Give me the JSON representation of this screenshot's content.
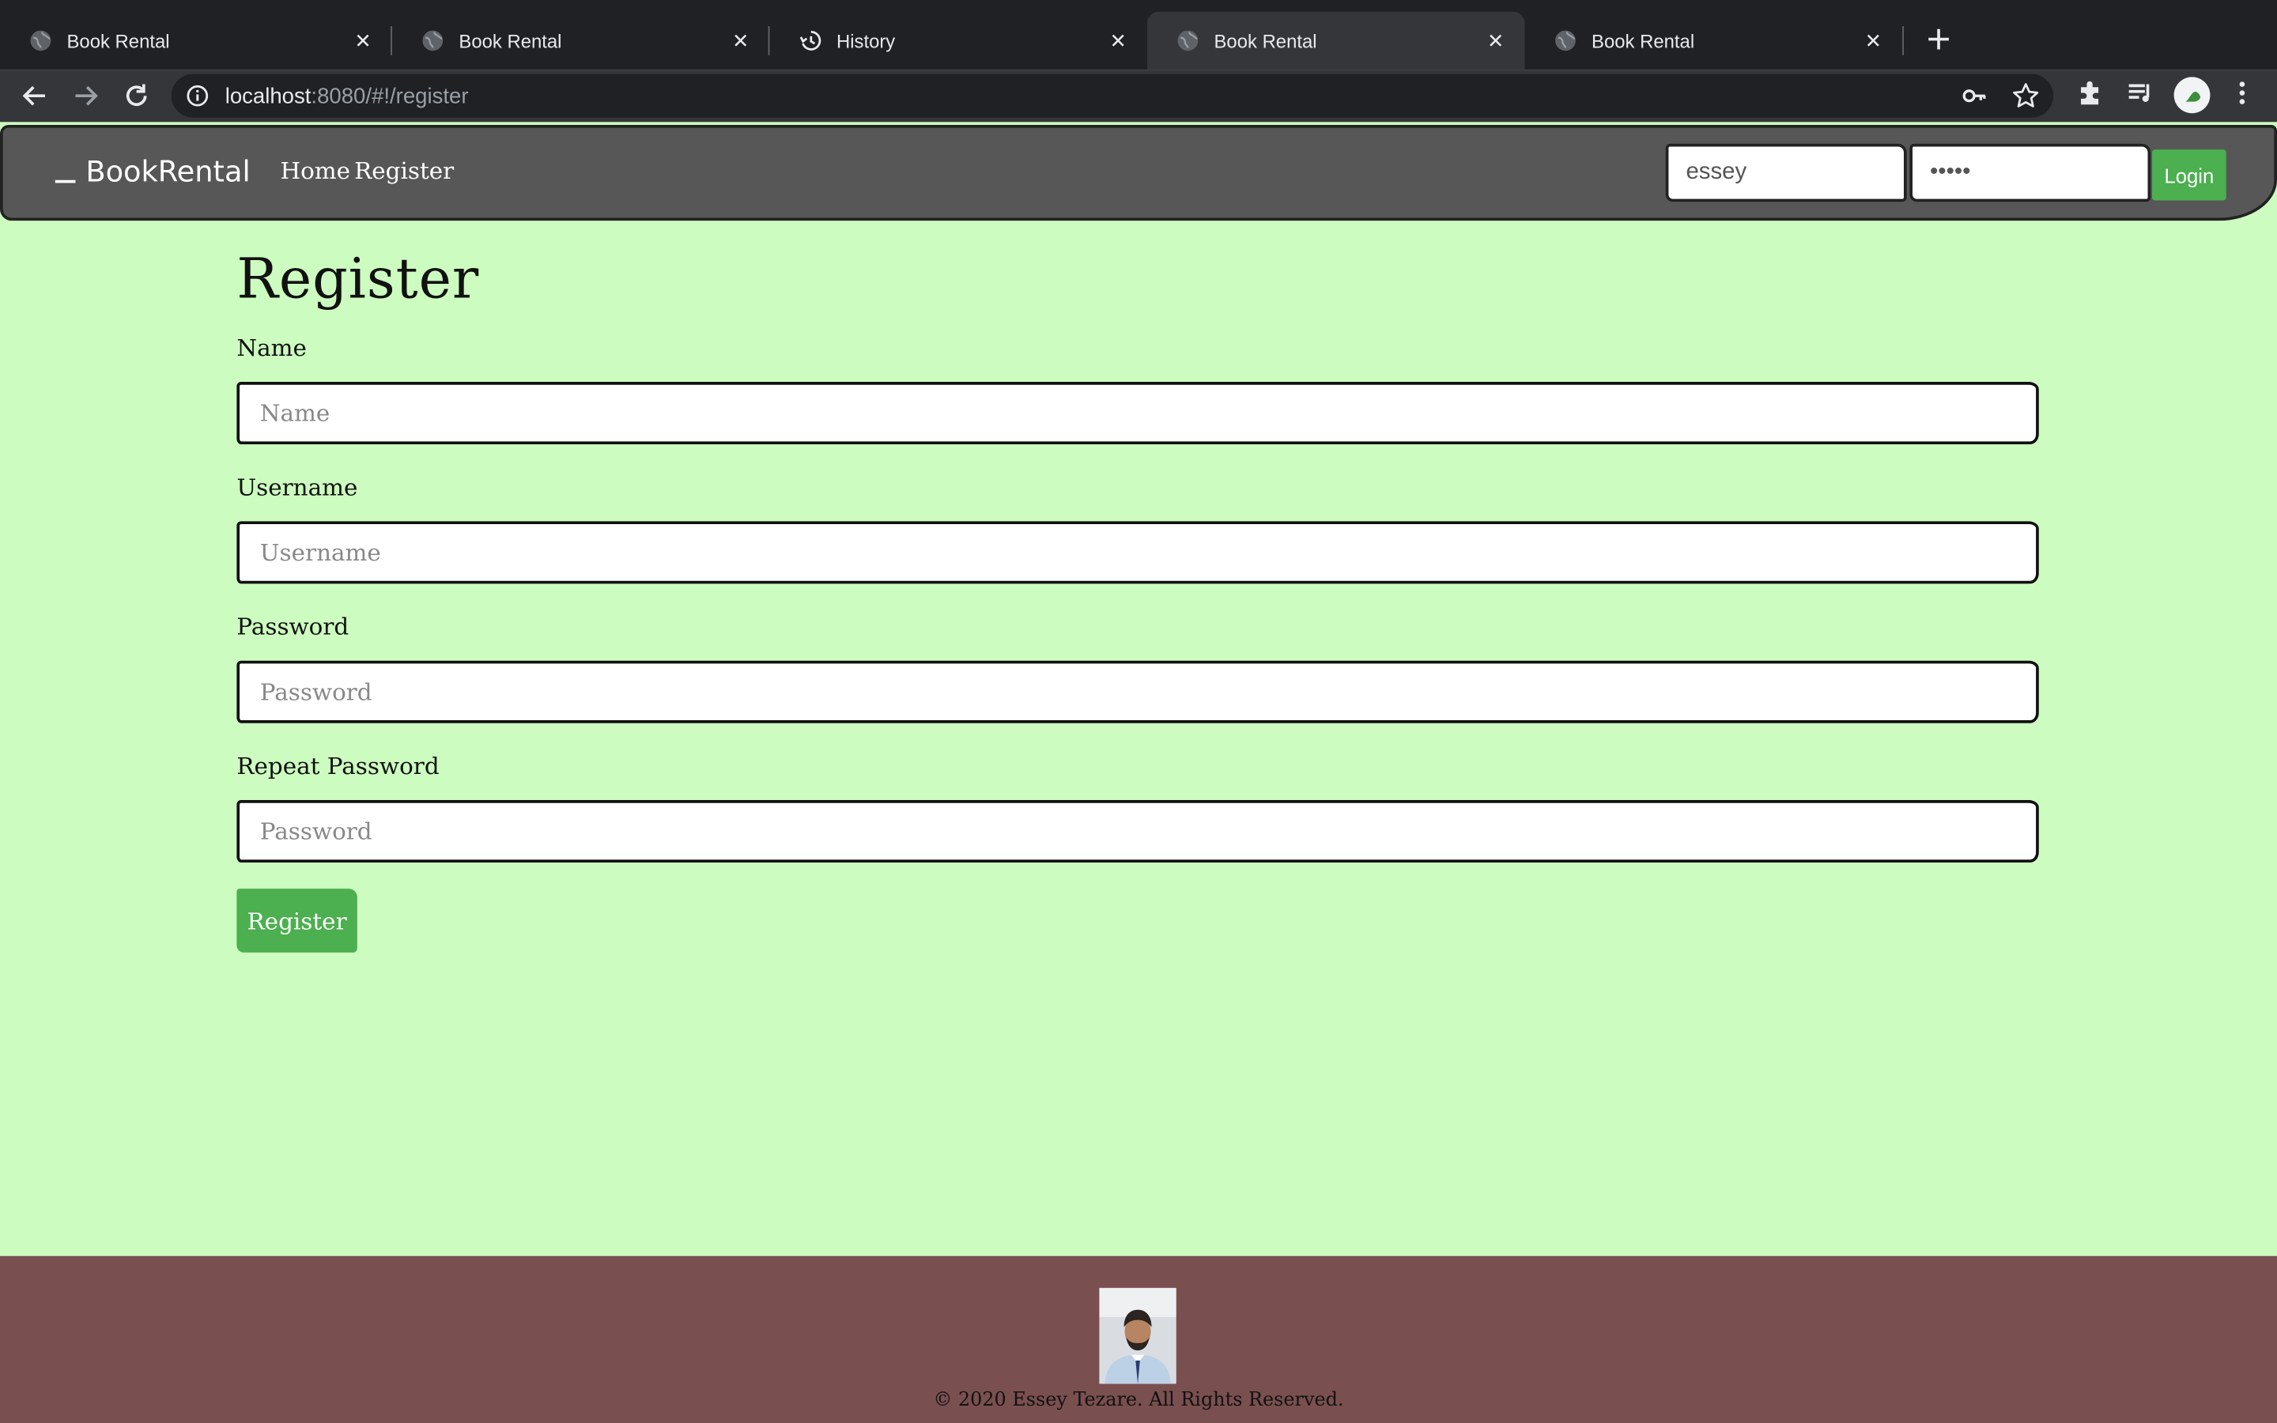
{
  "browser": {
    "tabs": [
      {
        "label": "Book Rental",
        "icon": "globe-icon",
        "active": false
      },
      {
        "label": "Book Rental",
        "icon": "globe-icon",
        "active": false
      },
      {
        "label": "History",
        "icon": "history-icon",
        "active": false
      },
      {
        "label": "Book Rental",
        "icon": "globe-icon",
        "active": true
      },
      {
        "label": "Book Rental",
        "icon": "globe-icon",
        "active": false
      }
    ],
    "url_host": "localhost",
    "url_rest": ":8080/#!/register"
  },
  "navbar": {
    "brand": "BookRental",
    "links": {
      "home": "Home",
      "register": "Register"
    },
    "login_username": "essey",
    "login_password": "•••••",
    "login_button": "Login"
  },
  "form": {
    "title": "Register",
    "fields": [
      {
        "label": "Name",
        "placeholder": "Name"
      },
      {
        "label": "Username",
        "placeholder": "Username"
      },
      {
        "label": "Password",
        "placeholder": "Password"
      },
      {
        "label": "Repeat Password",
        "placeholder": "Password"
      }
    ],
    "submit": "Register"
  },
  "footer": {
    "copyright": "© 2020 Essey Tezare. All Rights Reserved."
  },
  "colors": {
    "page_bg": "#ccfcbf",
    "navbar_bg": "#575757",
    "accent_green": "#4caf50",
    "footer_bg": "#7a4f4f"
  }
}
